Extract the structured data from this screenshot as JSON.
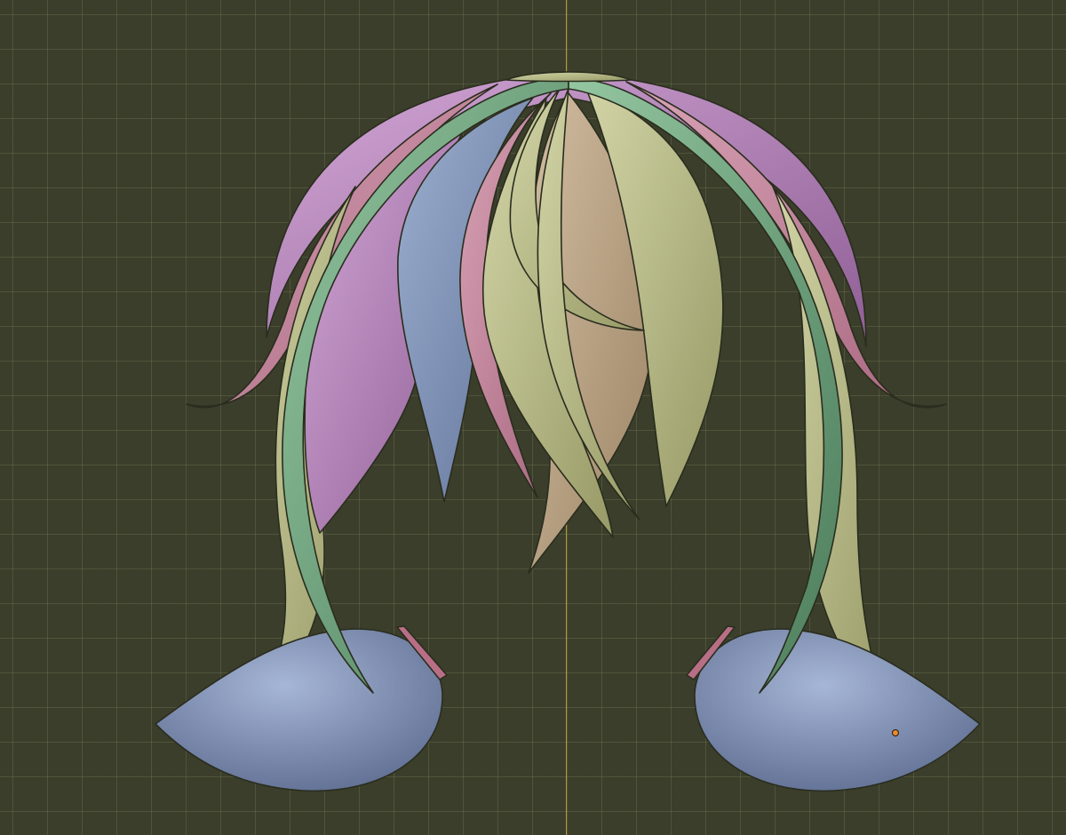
{
  "viewport": {
    "background_color": "#3a3e2a",
    "grid_color": "#6e7658",
    "axis_color": "#c8a23a",
    "selected_vertex_color": "#e88a2e"
  },
  "model": {
    "colors": {
      "blue": "#7f93b8",
      "pink": "#c8879f",
      "purple": "#b07fb6",
      "green": "#6fa57f",
      "yellow_green": "#b8bb84",
      "tan": "#b8a07e",
      "rim": "#b86f86",
      "outline": "#2a2d1e"
    }
  }
}
